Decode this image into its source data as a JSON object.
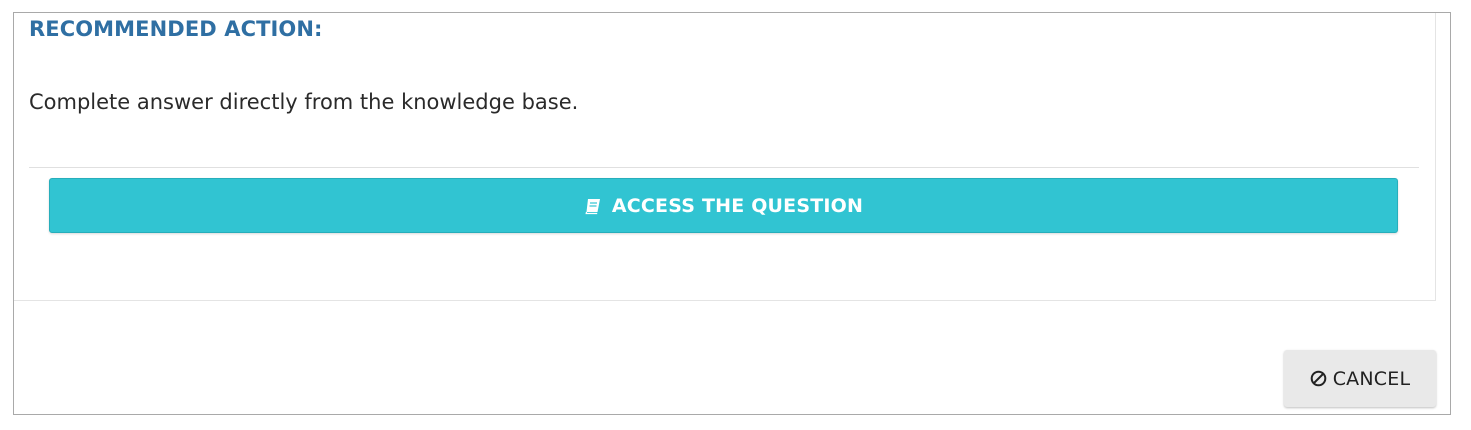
{
  "recommendation": {
    "heading": "RECOMMENDED ACTION:",
    "text": "Complete answer directly from the knowledge base."
  },
  "actions": {
    "access_label": "ACCESS THE QUESTION",
    "access_icon": "book-icon",
    "cancel_label": "CANCEL",
    "cancel_icon": "ban-icon"
  },
  "colors": {
    "heading": "#2f6fa3",
    "access_button": "#31c4d2",
    "cancel_button": "#e9e9e9"
  }
}
